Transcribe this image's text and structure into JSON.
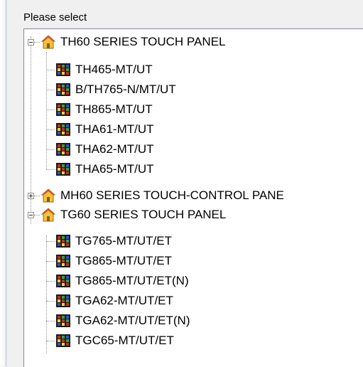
{
  "dialog": {
    "prompt": "Please select"
  },
  "tree": {
    "groups": [
      {
        "label": "TH60 SERIES TOUCH PANEL",
        "expanded": true,
        "children": [
          "TH465-MT/UT",
          "B/TH765-N/MT/UT",
          "TH865-MT/UT",
          "THA61-MT/UT",
          "THA62-MT/UT",
          "THA65-MT/UT"
        ]
      },
      {
        "label": "MH60 SERIES TOUCH-CONTROL PANE",
        "expanded": false,
        "children": []
      },
      {
        "label": "TG60 SERIES TOUCH PANEL",
        "expanded": true,
        "children": [
          "TG765-MT/UT/ET",
          "TG865-MT/UT/ET",
          "TG865-MT/UT/ET(N)",
          "TGA62-MT/UT/ET",
          "TGA62-MT/UT/ET(N)",
          "TGC65-MT/UT/ET"
        ]
      }
    ]
  },
  "icons": {
    "group": "house-icon",
    "item": "panel-grid-icon"
  },
  "colors": {
    "house_roof": "#d9522b",
    "house_body": "#f5c33b",
    "panel_red": "#cf2a1f",
    "panel_yellow": "#f3d33a",
    "panel_green": "#3aa23a",
    "panel_blue": "#2c55c9"
  }
}
